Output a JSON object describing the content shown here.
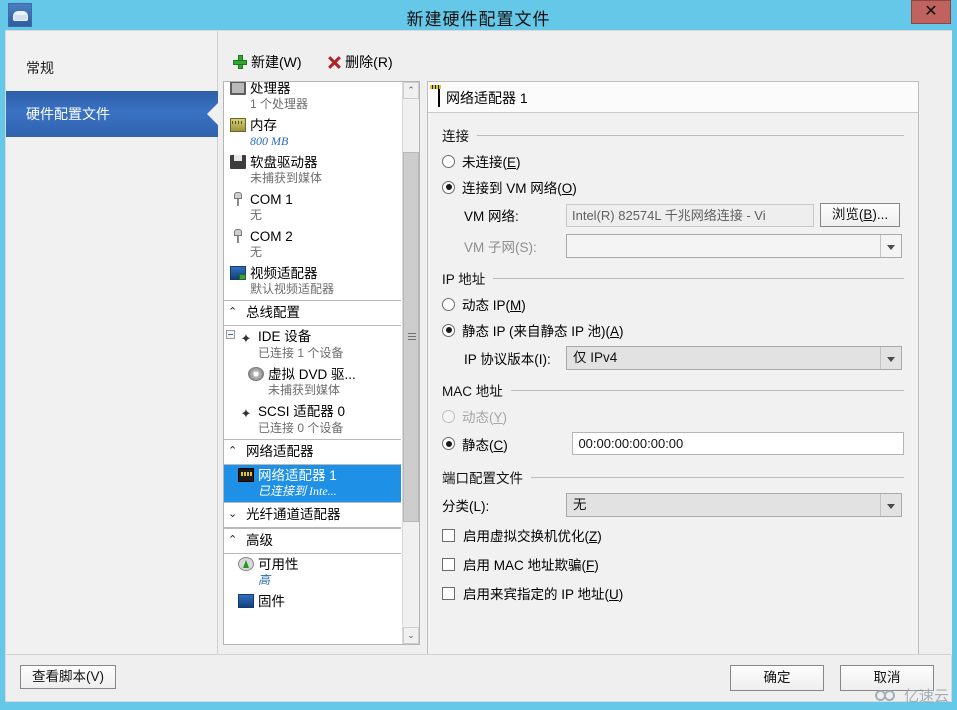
{
  "window": {
    "title": "新建硬件配置文件",
    "close_label": "✕",
    "app_icon": "server-cloud-icon",
    "titlebar_color": "#66c8e8"
  },
  "sidebar": {
    "items": [
      {
        "label": "常规",
        "selected": false
      },
      {
        "label": "硬件配置文件",
        "selected": true
      }
    ]
  },
  "toolbar": {
    "new_label": "新建(W)",
    "delete_label": "删除(R)"
  },
  "tree": {
    "rows": [
      {
        "kind": "item",
        "icon": "cpu-icon",
        "title": "处理器",
        "subtitle": "1 个处理器",
        "sub_style": "plain"
      },
      {
        "kind": "item",
        "icon": "memory-icon",
        "title": "内存",
        "subtitle": "800 MB",
        "sub_style": "link"
      },
      {
        "kind": "item",
        "icon": "floppy-icon",
        "title": "软盘驱动器",
        "subtitle": "未捕获到媒体",
        "sub_style": "plain"
      },
      {
        "kind": "item",
        "icon": "com-port-icon",
        "title": "COM 1",
        "subtitle": "无",
        "sub_style": "plain"
      },
      {
        "kind": "item",
        "icon": "com-port-icon",
        "title": "COM 2",
        "subtitle": "无",
        "sub_style": "plain"
      },
      {
        "kind": "item",
        "icon": "video-icon",
        "title": "视频适配器",
        "subtitle": "默认视频适配器",
        "sub_style": "plain"
      },
      {
        "kind": "group",
        "caret": "⌃",
        "title": "总线配置"
      },
      {
        "kind": "item",
        "icon": "ide-icon",
        "title": "IDE 设备",
        "subtitle": "已连接 1 个设备",
        "sub_style": "plain",
        "expander": true
      },
      {
        "kind": "child",
        "icon": "dvd-icon",
        "title": "虚拟 DVD 驱...",
        "subtitle": "未捕获到媒体",
        "sub_style": "plain"
      },
      {
        "kind": "item",
        "icon": "ide-icon",
        "title": "SCSI 适配器 0",
        "subtitle": "已连接 0 个设备",
        "sub_style": "plain"
      },
      {
        "kind": "group",
        "caret": "⌃",
        "title": "网络适配器"
      },
      {
        "kind": "item",
        "icon": "network-icon",
        "title": "网络适配器 1",
        "subtitle": "已连接到 Inte...",
        "sub_style": "link",
        "selected": true
      },
      {
        "kind": "group",
        "caret": "⌄",
        "title": "光纤通道适配器"
      },
      {
        "kind": "group",
        "caret": "⌃",
        "title": "高级"
      },
      {
        "kind": "item",
        "icon": "availability-icon",
        "title": "可用性",
        "subtitle": "高",
        "sub_style": "link"
      },
      {
        "kind": "item",
        "icon": "firmware-icon",
        "title": "固件",
        "subtitle": "",
        "sub_style": "plain"
      }
    ],
    "scroll_up": "⌃",
    "scroll_down": "⌄"
  },
  "details": {
    "header": "网络适配器 1",
    "header_icon": "network-icon",
    "connection": {
      "section_label": "连接",
      "not_connected": {
        "label_pre": "未连接(",
        "accel": "E",
        "label_post": ")",
        "checked": false
      },
      "connected_vm": {
        "label_pre": "连接到 VM 网络(",
        "accel": "O",
        "label_post": ")",
        "checked": true
      },
      "vm_network_label": "VM 网络:",
      "vm_network_value": "Intel(R) 82574L 千兆网络连接 - Vi",
      "browse_button": {
        "label_pre": "浏览(",
        "accel": "B",
        "label_post": ")..."
      },
      "vm_subnet_label": "VM 子网(S):",
      "vm_subnet_value": ""
    },
    "ip": {
      "section_label": "IP 地址",
      "dynamic": {
        "label_pre": "动态 IP(",
        "accel": "M",
        "label_post": ")",
        "checked": false
      },
      "static": {
        "label_pre": "静态 IP (来自静态 IP 池)(",
        "accel": "A",
        "label_post": ")",
        "checked": true
      },
      "version_label": "IP 协议版本(I):",
      "version_value": "仅 IPv4"
    },
    "mac": {
      "section_label": "MAC 地址",
      "dynamic": {
        "label_pre": "动态(",
        "accel": "Y",
        "label_post": ")",
        "checked": false,
        "disabled": true
      },
      "static": {
        "label_pre": "静态(",
        "accel": "C",
        "label_post": ")",
        "checked": true
      },
      "static_value": "00:00:00:00:00:00"
    },
    "port_profile": {
      "section_label": "端口配置文件",
      "classification_label": "分类(L):",
      "classification_value": "无",
      "checkboxes": [
        {
          "label_pre": "启用虚拟交换机优化(",
          "accel": "Z",
          "label_post": ")",
          "checked": false
        },
        {
          "label_pre": "启用 MAC 地址欺骗(",
          "accel": "F",
          "label_post": ")",
          "checked": false
        },
        {
          "label_pre": "启用来宾指定的 IP 地址(",
          "accel": "U",
          "label_post": ")",
          "checked": false
        }
      ]
    }
  },
  "footer": {
    "view_script": "查看脚本(V)",
    "ok": "确定",
    "cancel": "取消"
  },
  "watermark": {
    "text": "亿速云"
  }
}
